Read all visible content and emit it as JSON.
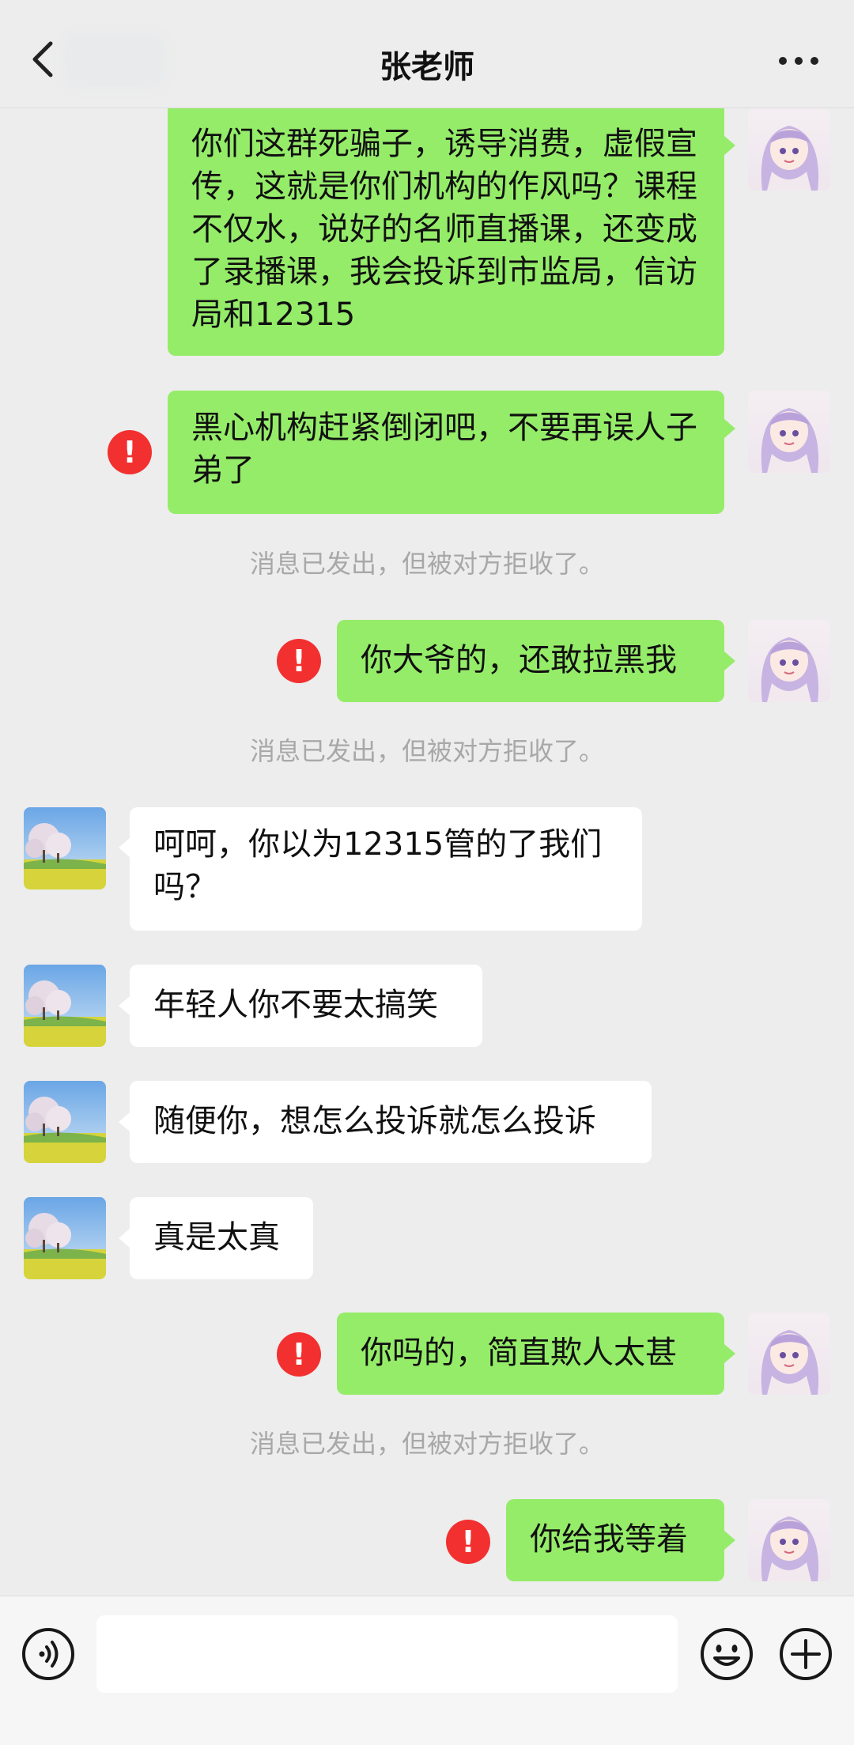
{
  "header": {
    "title": "张老师",
    "back_icon": "chevron-left-icon",
    "more_icon": "more-icon"
  },
  "messages": [
    {
      "from": "me",
      "text": "你们这群死骗子，诱导消费，虚假宣传，这就是你们机构的作风吗？课程不仅水，说好的名师直播课，还变成了录播课，我会投诉到市监局，信访局和12315",
      "failed": false
    },
    {
      "from": "me",
      "text": "黑心机构赶紧倒闭吧，不要再误人子弟了",
      "failed": true
    },
    {
      "from": "me",
      "text": "你大爷的，还敢拉黑我",
      "failed": true
    },
    {
      "from": "them",
      "text": "呵呵，你以为12315管的了我们吗？"
    },
    {
      "from": "them",
      "text": "年轻人你不要太搞笑"
    },
    {
      "from": "them",
      "text": "随便你，想怎么投诉就怎么投诉"
    },
    {
      "from": "them",
      "text": "真是太真"
    },
    {
      "from": "me",
      "text": "你吗的，简直欺人太甚",
      "failed": true
    },
    {
      "from": "me",
      "text": "你给我等着",
      "failed": true
    }
  ],
  "system_notice": "消息已发出，但被对方拒收了。",
  "error_mark": "!",
  "input_bar": {
    "voice_icon": "voice-icon",
    "emoji_icon": "emoji-icon",
    "plus_icon": "plus-icon",
    "text_value": ""
  },
  "colors": {
    "background": "#ededed",
    "my_bubble": "#95ec69",
    "their_bubble": "#ffffff",
    "error": "#f23030",
    "notice_text": "#a8a8a8"
  }
}
